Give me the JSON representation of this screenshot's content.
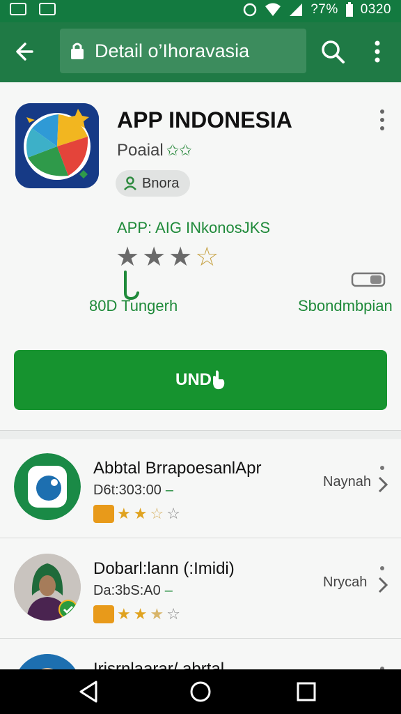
{
  "status_bar": {
    "battery": "?7%",
    "time": "0320"
  },
  "app_bar": {
    "url_title": "Detail o’Ihoravasia",
    "icons": [
      "back-arrow-icon",
      "lock-icon",
      "search-icon",
      "more-vert-icon"
    ]
  },
  "app_card": {
    "title": "APP INDONESIA",
    "subtitle": "Poaial",
    "subtitle_stars": "✩✩",
    "chip_label": "Bnora",
    "tag_line": "APP: AIG INkonosJKS",
    "rating": 3,
    "rating_max": 4,
    "stat_left": "80D Tungerh",
    "stat_right": "Sbondmbpian",
    "install_label": "UND",
    "colors": {
      "primary": "#1f7a45",
      "button": "#16932f",
      "accent_text": "#1f8a3a"
    }
  },
  "list": {
    "items": [
      {
        "title": "Abbtal BrrapoesanlApr",
        "subtitle": "D6t:303:00",
        "rating": 2.5,
        "rating_max": 5,
        "action": "Naynah"
      },
      {
        "title": "Dobarl:lann (:Imidi)",
        "subtitle": "Da:3bS:A0",
        "rating": 2.5,
        "rating_max": 5,
        "action": "Nrycah"
      },
      {
        "title": "Irisrnlaarar/ abrtal",
        "subtitle": "",
        "rating": 0,
        "rating_max": 5,
        "action": ""
      }
    ]
  },
  "nav_bar": {
    "icons": [
      "back-triangle-icon",
      "home-circle-icon",
      "recents-square-icon"
    ]
  }
}
